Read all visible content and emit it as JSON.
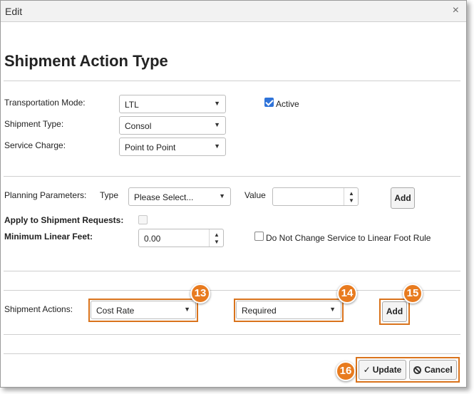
{
  "window": {
    "title": "Edit",
    "close_glyph": "×"
  },
  "page_title": "Shipment Action Type",
  "general": {
    "transportation_mode": {
      "label": "Transportation Mode:",
      "value": "LTL"
    },
    "shipment_type": {
      "label": "Shipment Type:",
      "value": "Consol"
    },
    "service_charge": {
      "label": "Service Charge:",
      "value": "Point to Point"
    },
    "active": {
      "label": "Active",
      "checked": true
    }
  },
  "planning": {
    "label": "Planning Parameters:",
    "type_label": "Type",
    "type_value": "Please Select...",
    "value_label": "Value",
    "value_value": "",
    "add_label": "Add"
  },
  "apply_to_shipment_requests": {
    "label": "Apply to Shipment Requests:",
    "checked": false
  },
  "minimum_linear_feet": {
    "label": "Minimum Linear Feet:",
    "value": "0.00"
  },
  "do_not_change": {
    "label": "Do Not Change Service to Linear Foot Rule",
    "checked": false
  },
  "shipment_actions": {
    "label": "Shipment Actions:",
    "action_value": "Cost Rate",
    "requirement_value": "Required",
    "add_label": "Add"
  },
  "footer": {
    "update_label": "Update",
    "cancel_label": "Cancel"
  },
  "callouts": [
    "13",
    "14",
    "15",
    "16"
  ],
  "colors": {
    "callout": "#e87b1f",
    "highlight": "#d9731c",
    "checkbox_checked": "#2f73d9"
  },
  "icons": {
    "dropdown": "chevron-down-icon",
    "spinner_up": "arrow-up-icon",
    "spinner_down": "arrow-down-icon",
    "update": "checkmark-icon",
    "cancel": "cancel-circle-icon",
    "close": "close-icon"
  }
}
